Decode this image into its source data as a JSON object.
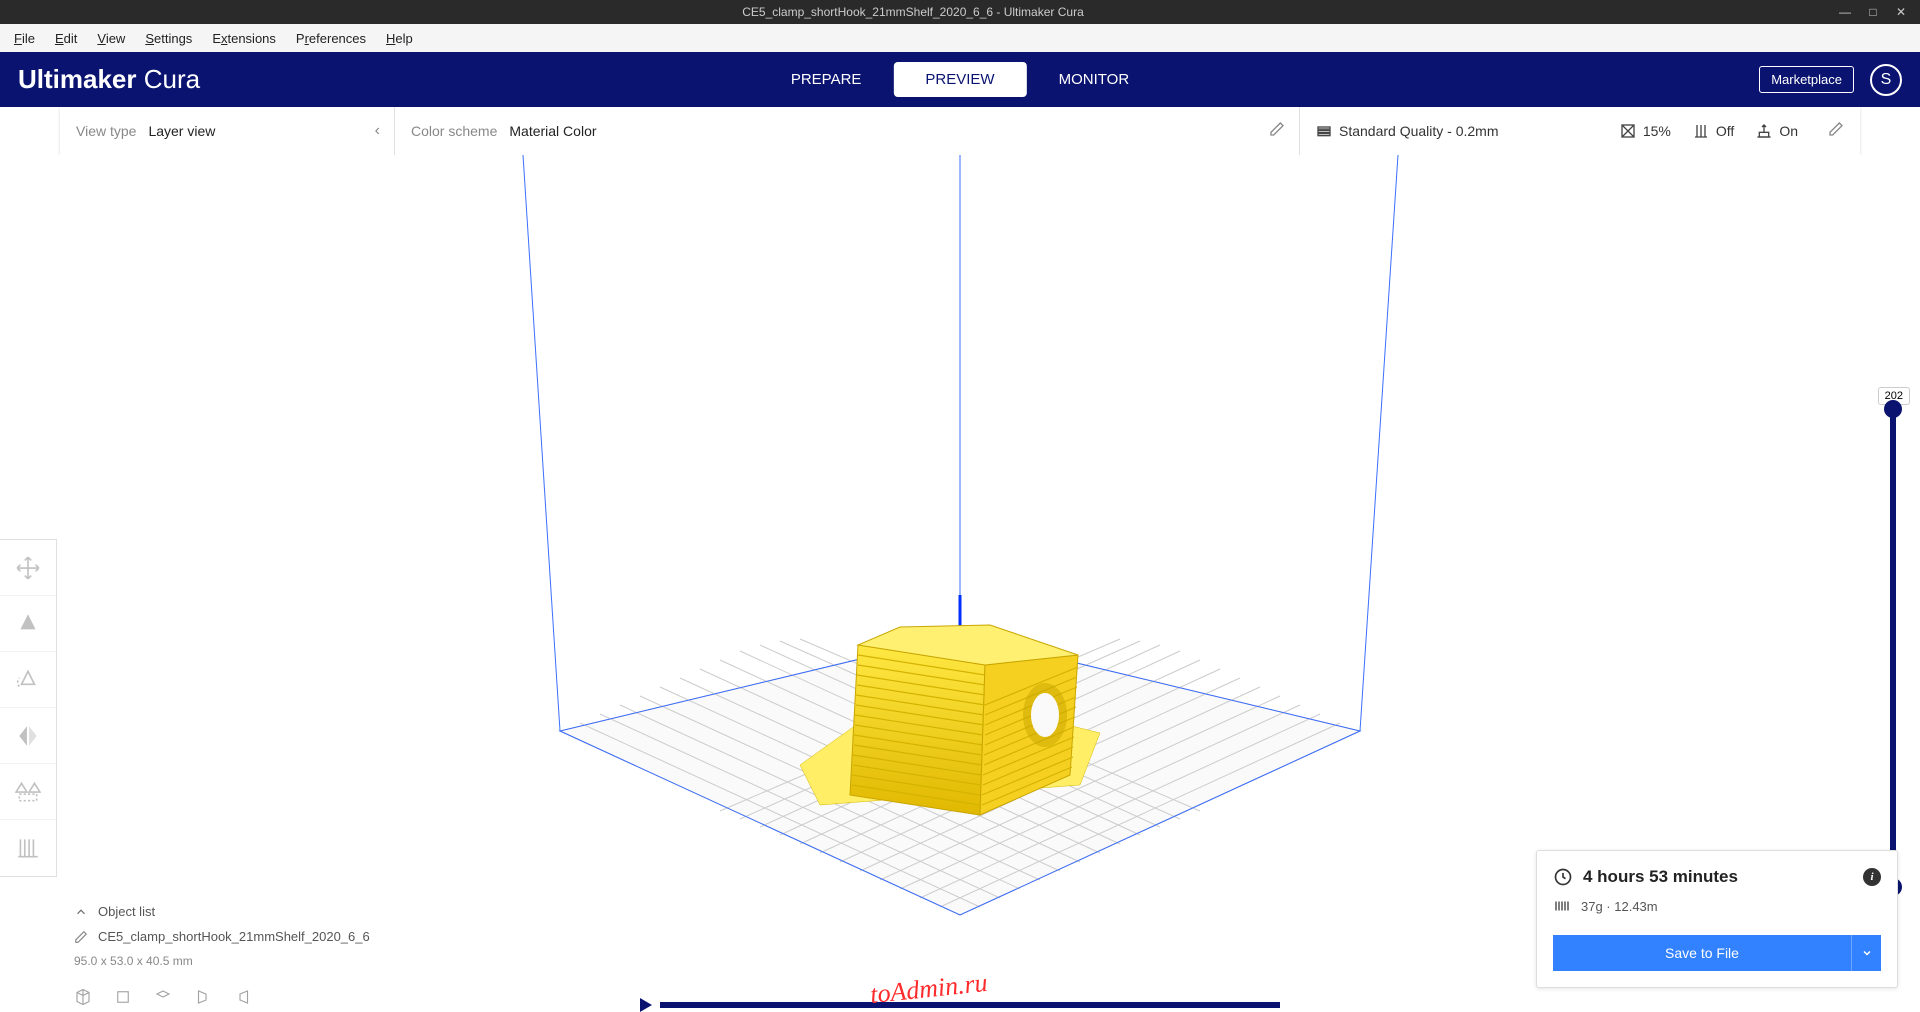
{
  "titlebar": {
    "title": "CE5_clamp_shortHook_21mmShelf_2020_6_6 - Ultimaker Cura"
  },
  "menubar": [
    "File",
    "Edit",
    "View",
    "Settings",
    "Extensions",
    "Preferences",
    "Help"
  ],
  "logo": {
    "brand": "Ultimaker",
    "product": "Cura"
  },
  "header_tabs": [
    {
      "label": "PREPARE",
      "active": false
    },
    {
      "label": "PREVIEW",
      "active": true
    },
    {
      "label": "MONITOR",
      "active": false
    }
  ],
  "marketplace": "Marketplace",
  "user_initial": "S",
  "config": {
    "viewtype_label": "View type",
    "viewtype_value": "Layer view",
    "colorscheme_label": "Color scheme",
    "colorscheme_value": "Material Color",
    "quality_value": "Standard Quality - 0.2mm",
    "infill_value": "15%",
    "support_value": "Off",
    "adhesion_value": "On"
  },
  "layer": {
    "current": "202"
  },
  "object": {
    "list_label": "Object list",
    "name": "CE5_clamp_shortHook_21mmShelf_2020_6_6",
    "dims": "95.0 x 53.0 x 40.5 mm"
  },
  "print": {
    "time": "4 hours 53 minutes",
    "material": "37g · 12.43m",
    "save_label": "Save to File"
  },
  "watermark": "toAdmin.ru"
}
